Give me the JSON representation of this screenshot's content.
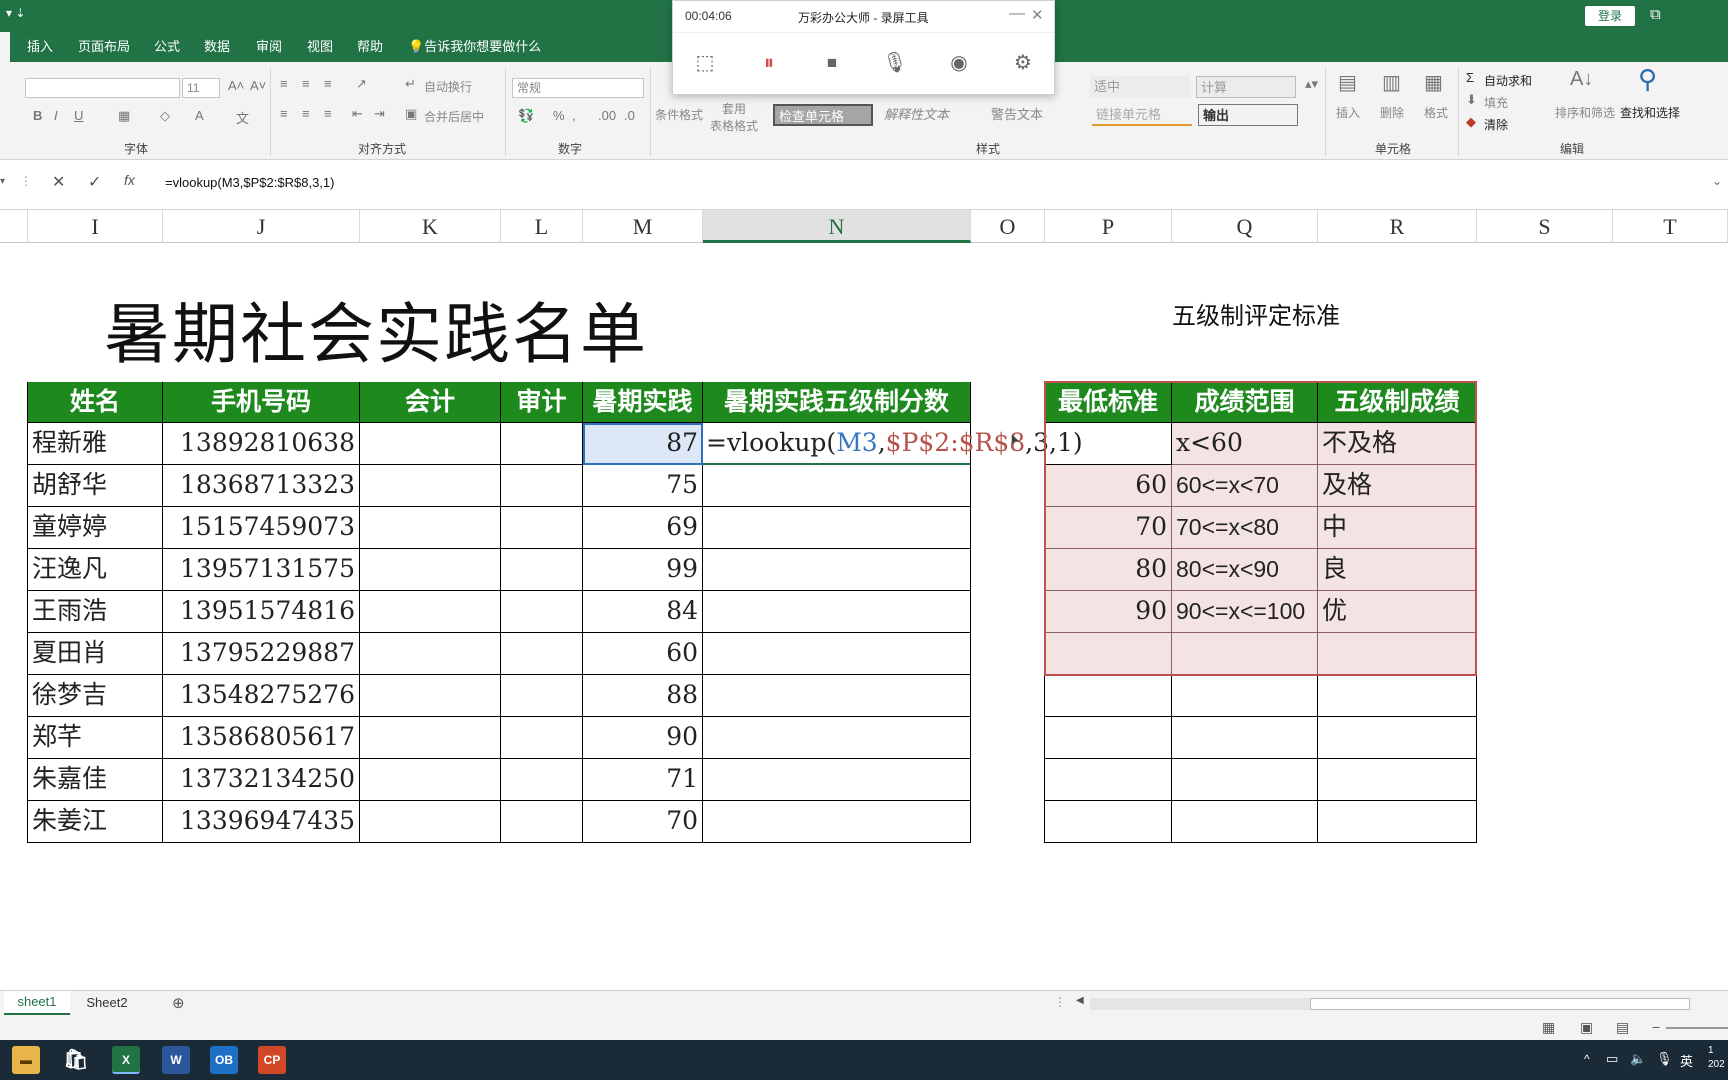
{
  "titlebar": {
    "login": "登录",
    "minimize": "—",
    "restore": "⧉",
    "close": "✕"
  },
  "ribbon_tabs": [
    "插入",
    "页面布局",
    "公式",
    "数据",
    "审阅",
    "视图",
    "帮助"
  ],
  "tell_me": "告诉我你想要做什么",
  "ribbon": {
    "font_size": "11",
    "wrap_text": "自动换行",
    "number_format": "常规",
    "merge_center": "合并后居中",
    "conditional_format": "条件格式",
    "table_format": "套用\n表格格式",
    "styles": {
      "neutral": "适中",
      "calc": "计算",
      "check": "检查单元格",
      "explain": "解释性文本",
      "warn": "警告文本",
      "link": "链接单元格",
      "output": "输出"
    },
    "insert": "插入",
    "delete": "删除",
    "format": "格式",
    "autosum": "自动求和",
    "fill": "填充",
    "clear": "清除",
    "sort_filter": "排序和筛选",
    "find_select": "查找和选择",
    "groups": {
      "font": "字体",
      "align": "对齐方式",
      "number": "数字",
      "styles": "样式",
      "cells": "单元格",
      "edit": "编辑"
    }
  },
  "recorder": {
    "time": "00:04:06",
    "title": "万彩办公大师 - 录屏工具"
  },
  "formula_bar": {
    "formula": "=vlookup(M3,$P$2:$R$8,3,1)"
  },
  "columns": [
    "I",
    "J",
    "K",
    "L",
    "M",
    "N",
    "O",
    "P",
    "Q",
    "R",
    "S",
    "T"
  ],
  "sheet": {
    "title": "暑期社会实践名单",
    "subtitle": "五级制评定标准",
    "main_headers": [
      "姓名",
      "手机号码",
      "会计",
      "审计",
      "暑期实践",
      "暑期实践五级制分数"
    ],
    "rows": [
      {
        "name": "程新雅",
        "phone": "13892810638",
        "score": "87"
      },
      {
        "name": "胡舒华",
        "phone": "18368713323",
        "score": "75"
      },
      {
        "name": "童婷婷",
        "phone": "15157459073",
        "score": "69"
      },
      {
        "name": "汪逸凡",
        "phone": "13957131575",
        "score": "99"
      },
      {
        "name": "王雨浩",
        "phone": "13951574816",
        "score": "84"
      },
      {
        "name": "夏田肖",
        "phone": "13795229887",
        "score": "60"
      },
      {
        "name": "徐梦吉",
        "phone": "13548275276",
        "score": "88"
      },
      {
        "name": "郑芊",
        "phone": "13586805617",
        "score": "90"
      },
      {
        "name": "朱嘉佳",
        "phone": "13732134250",
        "score": "71"
      },
      {
        "name": "朱姜江",
        "phone": "13396947435",
        "score": "70"
      }
    ],
    "edit_formula": {
      "prefix": "=vlookup(",
      "ref1": "M3",
      "comma1": ",",
      "ref2": "$P$2:$R$8",
      "rest": ",3,1)"
    },
    "grade_headers": [
      "最低标准",
      "成绩范围",
      "五级制成绩"
    ],
    "grade_rows": [
      {
        "min": "",
        "range": "x<60",
        "grade": "不及格"
      },
      {
        "min": "60",
        "range": "60<=x<70",
        "grade": "及格"
      },
      {
        "min": "70",
        "range": "70<=x<80",
        "grade": "中"
      },
      {
        "min": "80",
        "range": "80<=x<90",
        "grade": "良"
      },
      {
        "min": "90",
        "range": "90<=x<=100",
        "grade": "优"
      }
    ]
  },
  "sheet_tabs": [
    "sheet1",
    "Sheet2"
  ],
  "taskbar": {
    "ime": "英",
    "clock": "1\n202"
  },
  "colors": {
    "excel_green": "#217346",
    "header_green": "#1e8a1e",
    "pink": "#f4e3e3",
    "ref_blue": "#3a74c4",
    "ref_red": "#b5524b"
  }
}
